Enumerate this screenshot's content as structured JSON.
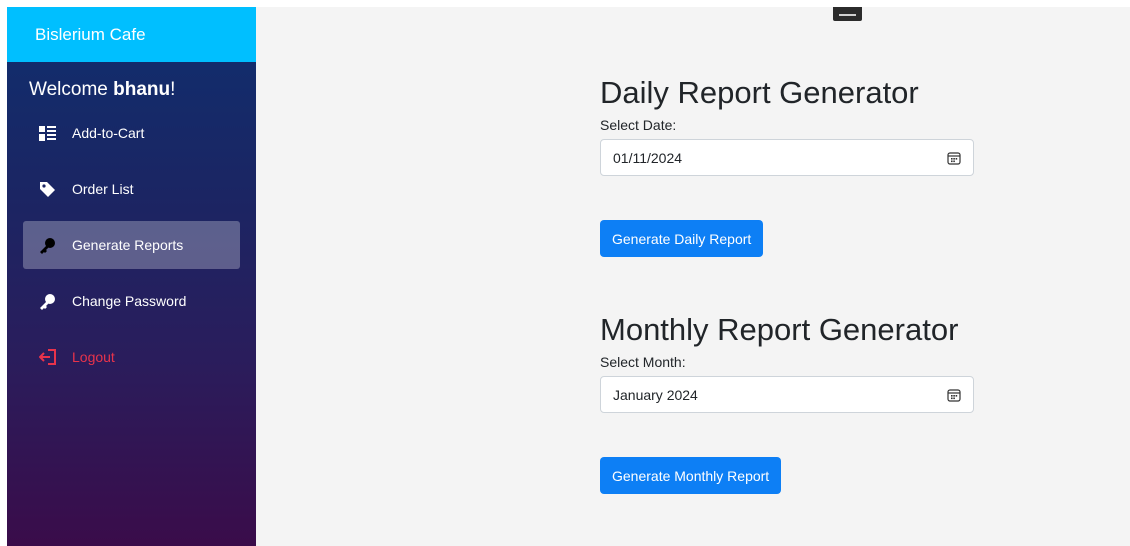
{
  "sidebar": {
    "brand": "Bislerium Cafe",
    "welcome_prefix": "Welcome ",
    "username": "bhanu",
    "welcome_suffix": "!",
    "items": [
      {
        "label": "Add-to-Cart",
        "icon": "grid-list-icon"
      },
      {
        "label": "Order List",
        "icon": "tag-icon"
      },
      {
        "label": "Generate Reports",
        "icon": "key-icon",
        "active": true
      },
      {
        "label": "Change Password",
        "icon": "key-icon"
      },
      {
        "label": "Logout",
        "icon": "logout-icon",
        "color": "#e8334b"
      }
    ]
  },
  "daily": {
    "title": "Daily Report Generator",
    "label": "Select Date:",
    "value": "01/11/2024",
    "button": "Generate Daily Report"
  },
  "monthly": {
    "title": "Monthly Report Generator",
    "label": "Select Month:",
    "value": "January 2024",
    "button": "Generate Monthly Report"
  },
  "colors": {
    "brand_bar": "#00bfff",
    "primary_button": "#0d7ff5",
    "logout": "#e8334b",
    "content_bg": "#f4f4f4"
  }
}
